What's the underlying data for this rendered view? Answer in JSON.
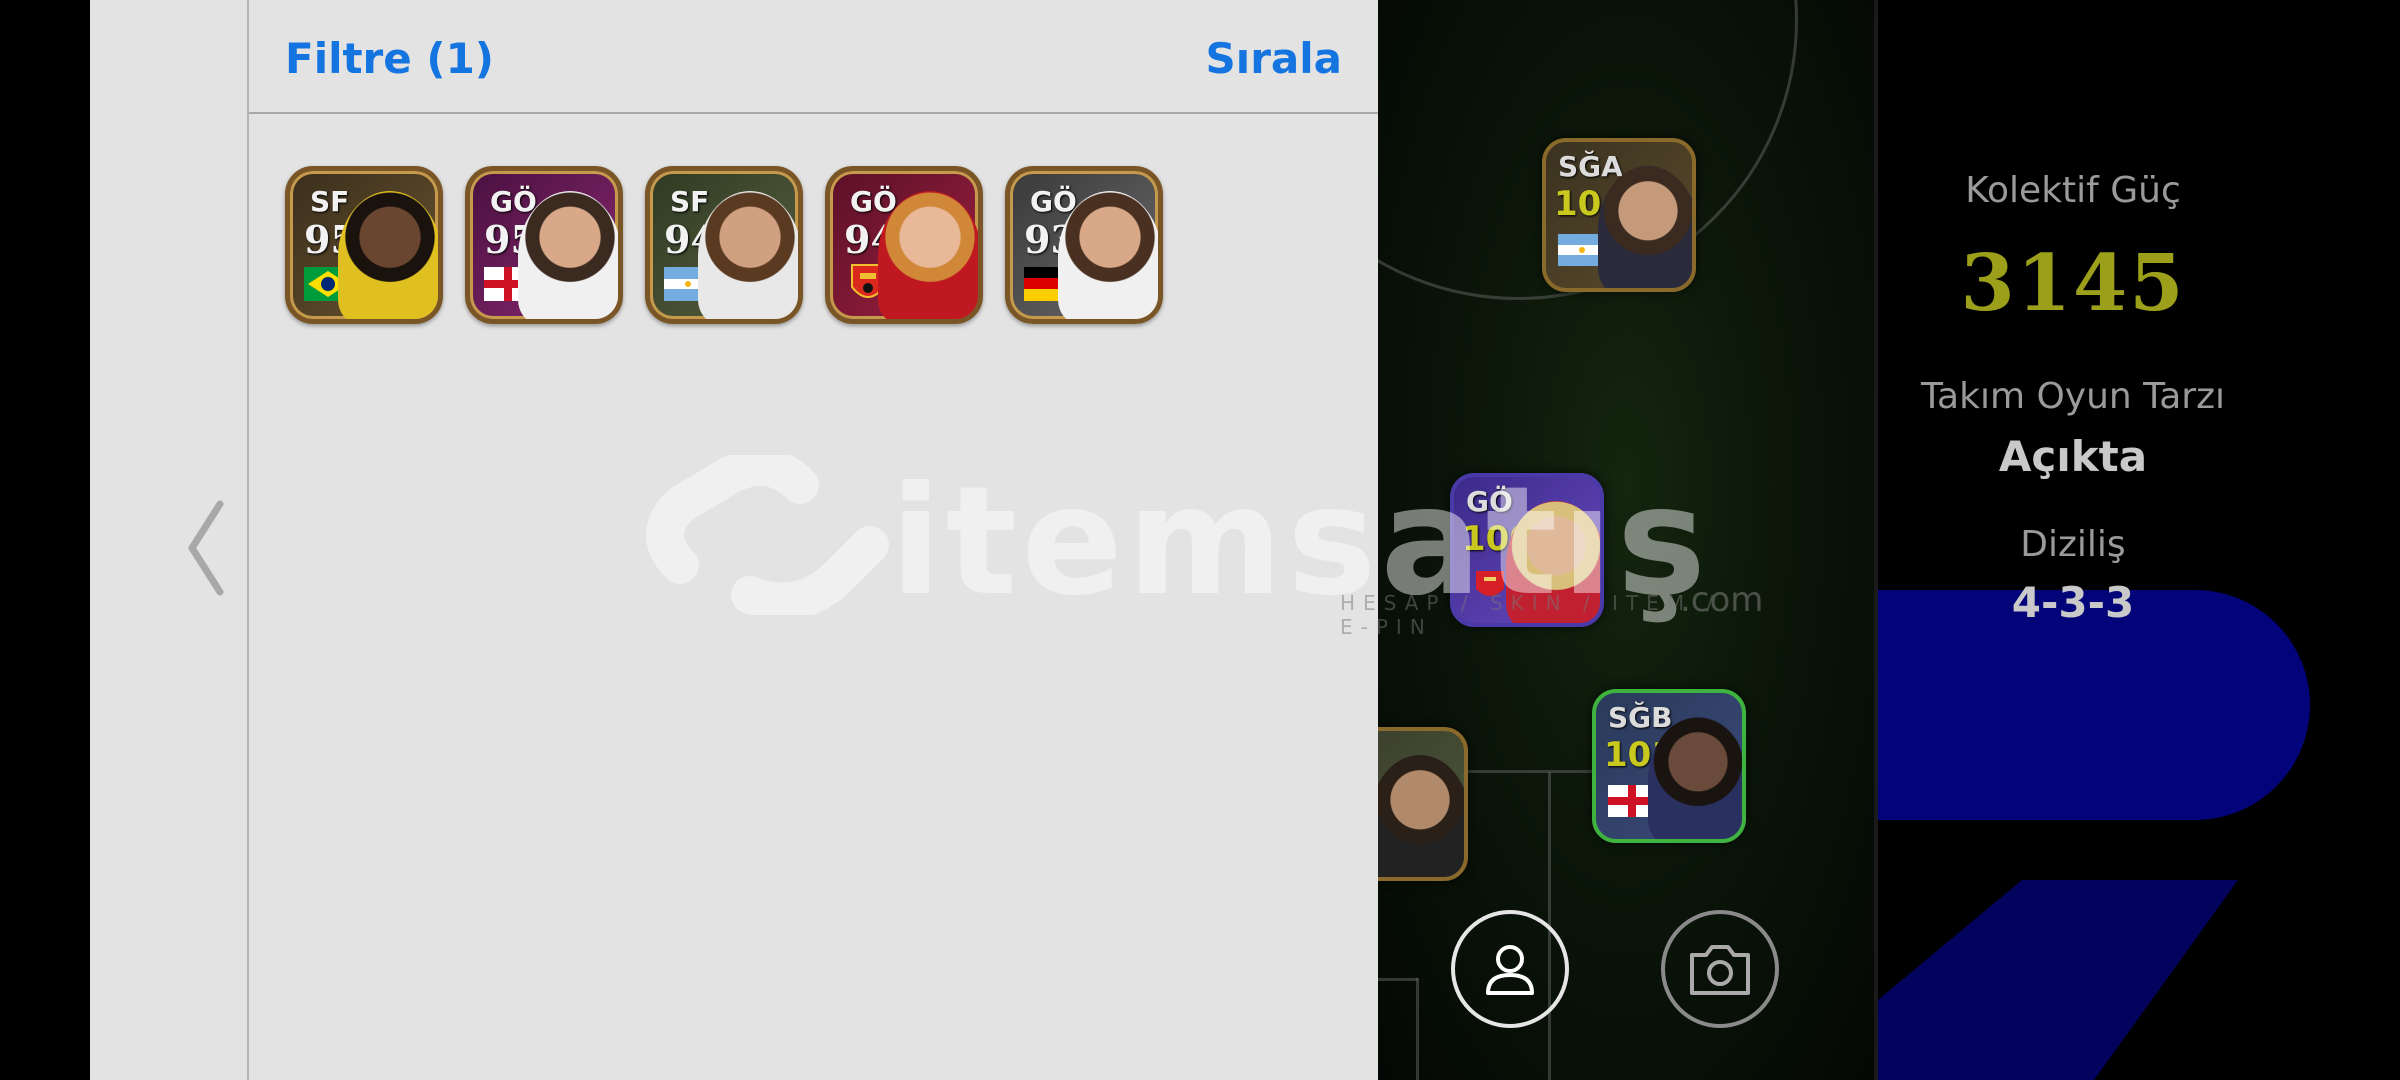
{
  "overlay": {
    "filter_label": "Filtre (1)",
    "sort_label": "Sırala",
    "cards": [
      {
        "position": "SF",
        "rating": "95",
        "flag": "brazil",
        "bg": "#4a3a22"
      },
      {
        "position": "GÖ",
        "rating": "95",
        "flag": "england",
        "bg": "#6b1d52"
      },
      {
        "position": "SF",
        "rating": "94",
        "flag": "argentina",
        "bg": "#5a4a30"
      },
      {
        "position": "GÖ",
        "rating": "94",
        "flag": "manchester-united-crest",
        "bg": "#7b1a3a"
      },
      {
        "position": "GÖ",
        "rating": "93",
        "flag": "germany",
        "bg": "#4a4a4a"
      }
    ]
  },
  "team": {
    "power_label": "Kolektif Güç",
    "power_value": "3145",
    "style_label": "Takım Oyun Tarzı",
    "style_value": "Açıkta",
    "formation_label": "Diziliş",
    "formation_value": "4-3-3"
  },
  "pitch_cards": [
    {
      "position": "SĞA",
      "rating": "104",
      "flag": "argentina"
    },
    {
      "position": "GÖ",
      "rating": "100",
      "flag": "arsenal-crest"
    },
    {
      "position": "SĞB",
      "rating": "101",
      "flag": "england"
    }
  ],
  "buttons": {
    "profile_icon": "person-icon",
    "camera_icon": "camera-icon"
  },
  "watermark": {
    "brand": "itemsatış",
    "tagline": "HESAP / SKIN / ITEM / E-PIN",
    "domain": ".com"
  },
  "colors": {
    "accent_blue": "#1474e0",
    "power_yellow": "#9c9f1a",
    "overlay_bg": "#e3e3e3",
    "team_blue": "#03037a"
  }
}
